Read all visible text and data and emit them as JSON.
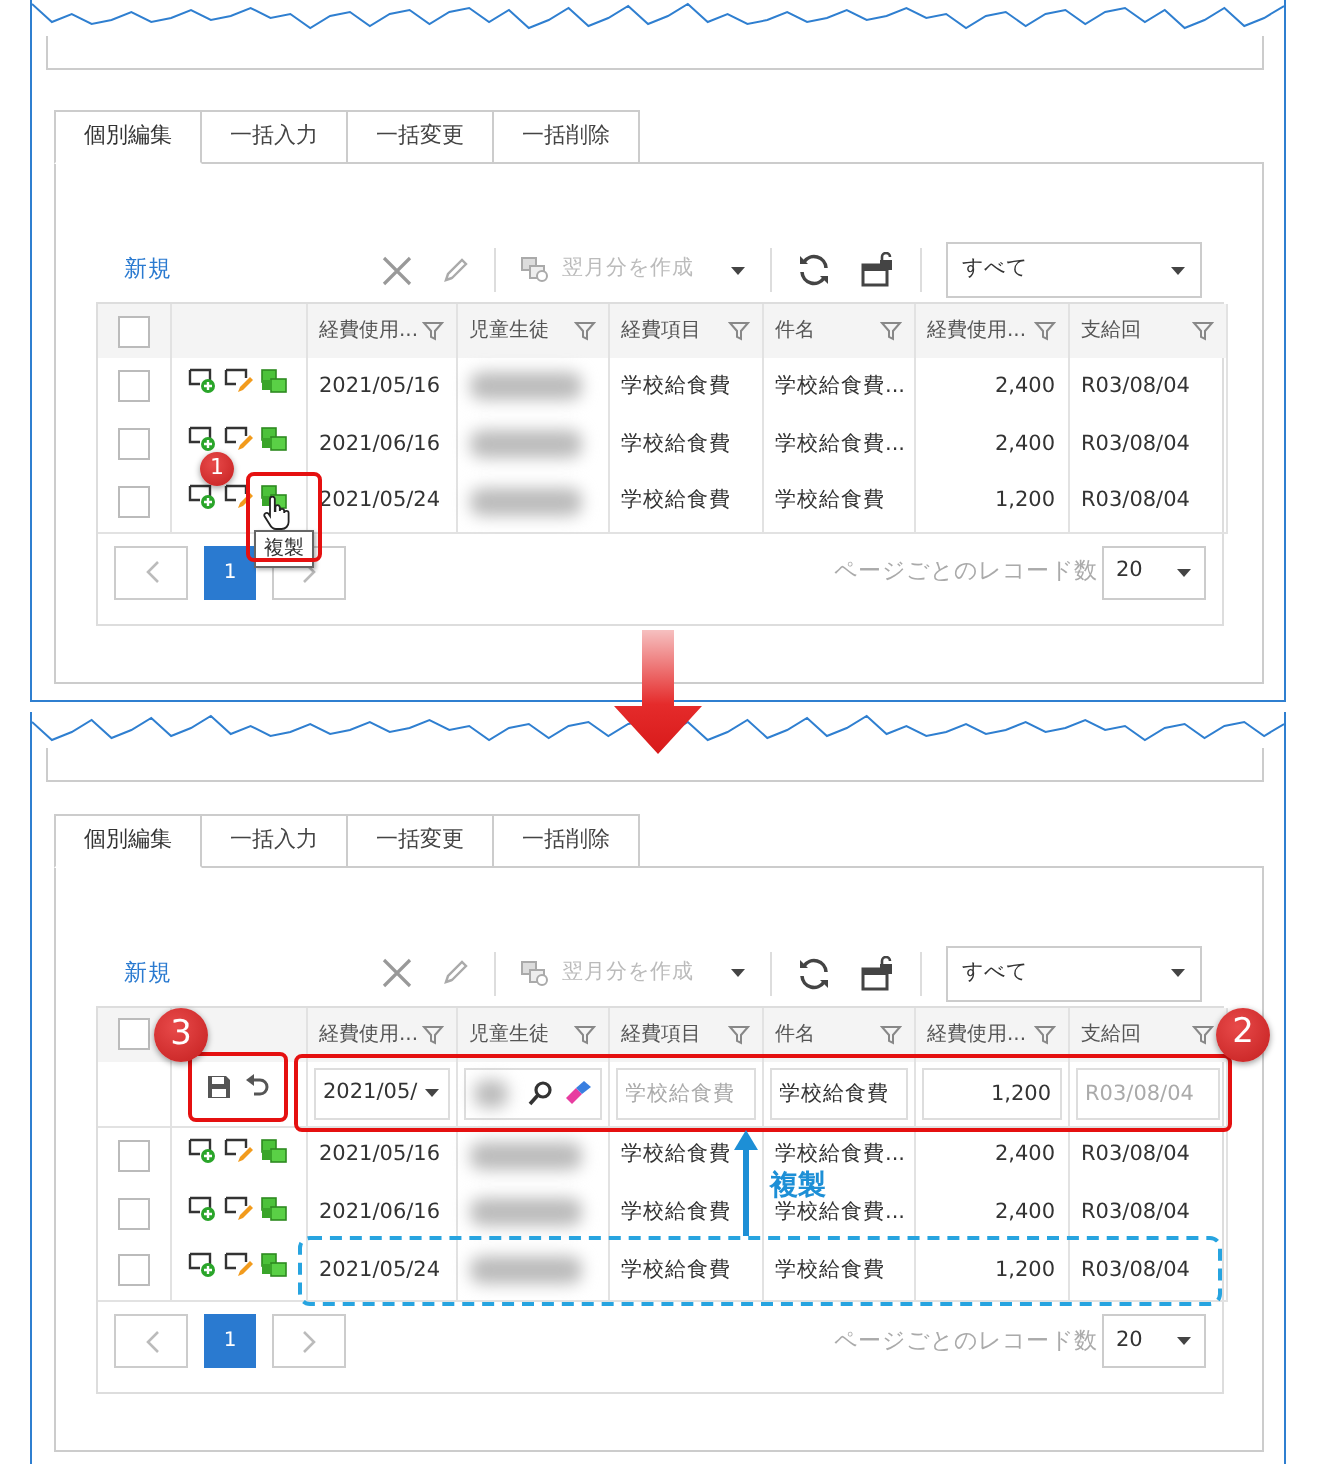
{
  "panels": [
    {
      "tabs": [
        {
          "label": "個別編集",
          "selected": true
        },
        {
          "label": "一括入力",
          "selected": false
        },
        {
          "label": "一括変更",
          "selected": false
        },
        {
          "label": "一括削除",
          "selected": false
        }
      ],
      "toolbar": {
        "new_label": "新規",
        "create_label": "翌月分を作成",
        "filter_value": "すべて"
      },
      "columns": [
        {
          "label": "経費使用..."
        },
        {
          "label": "児童生徒"
        },
        {
          "label": "経費項目"
        },
        {
          "label": "件名"
        },
        {
          "label": "経費使用..."
        },
        {
          "label": "支給回"
        }
      ],
      "header_checked": false,
      "rows": [
        {
          "checked": false,
          "date": "2021/05/16",
          "item": "学校給食費",
          "subject": "学校給食費...",
          "amount": "2,400",
          "payment": "R03/08/04"
        },
        {
          "checked": false,
          "date": "2021/06/16",
          "item": "学校給食費",
          "subject": "学校給食費...",
          "amount": "2,400",
          "payment": "R03/08/04"
        },
        {
          "checked": false,
          "date": "2021/05/24",
          "item": "学校給食費",
          "subject": "学校給食費",
          "amount": "1,200",
          "payment": "R03/08/04"
        }
      ],
      "pager": {
        "pages": [
          {
            "label": "1",
            "selected": true
          }
        ],
        "page_size_label": "ページごとのレコード数",
        "page_size": "20"
      },
      "callouts": [
        {
          "label": "1",
          "kind": "copy"
        }
      ],
      "tooltip": "複製"
    },
    {
      "tabs": [
        {
          "label": "個別編集",
          "selected": true
        },
        {
          "label": "一括入力",
          "selected": false
        },
        {
          "label": "一括変更",
          "selected": false
        },
        {
          "label": "一括削除",
          "selected": false
        }
      ],
      "toolbar": {
        "new_label": "新規",
        "create_label": "翌月分を作成",
        "filter_value": "すべて"
      },
      "columns": [
        {
          "label": "経費使用..."
        },
        {
          "label": "児童生徒"
        },
        {
          "label": "経費項目"
        },
        {
          "label": "件名"
        },
        {
          "label": "経費使用..."
        },
        {
          "label": "支給回"
        }
      ],
      "header_checked": false,
      "edit_row": {
        "date": "2021/05/",
        "item": "学校給食費",
        "item_disabled": true,
        "subject": "学校給食費",
        "amount": "1,200",
        "payment": "R03/08/04",
        "payment_disabled": true
      },
      "rows": [
        {
          "checked": false,
          "highlighted": false,
          "date": "2021/05/16",
          "item": "学校給食費",
          "subject": "学校給食費...",
          "amount": "2,400",
          "payment": "R03/08/04"
        },
        {
          "checked": false,
          "highlighted": false,
          "date": "2021/06/16",
          "item": "学校給食費",
          "subject": "学校給食費...",
          "amount": "2,400",
          "payment": "R03/08/04"
        },
        {
          "checked": false,
          "highlighted": true,
          "date": "2021/05/24",
          "item": "学校給食費",
          "subject": "学校給食費",
          "amount": "1,200",
          "payment": "R03/08/04"
        }
      ],
      "pager": {
        "pages": [
          {
            "label": "1",
            "selected": true
          }
        ],
        "page_size_label": "ページごとのレコード数",
        "page_size": "20"
      },
      "callouts": [
        {
          "label": "3",
          "kind": "actions"
        },
        {
          "label": "2",
          "kind": "row"
        }
      ],
      "arrow_label": "複製"
    }
  ]
}
